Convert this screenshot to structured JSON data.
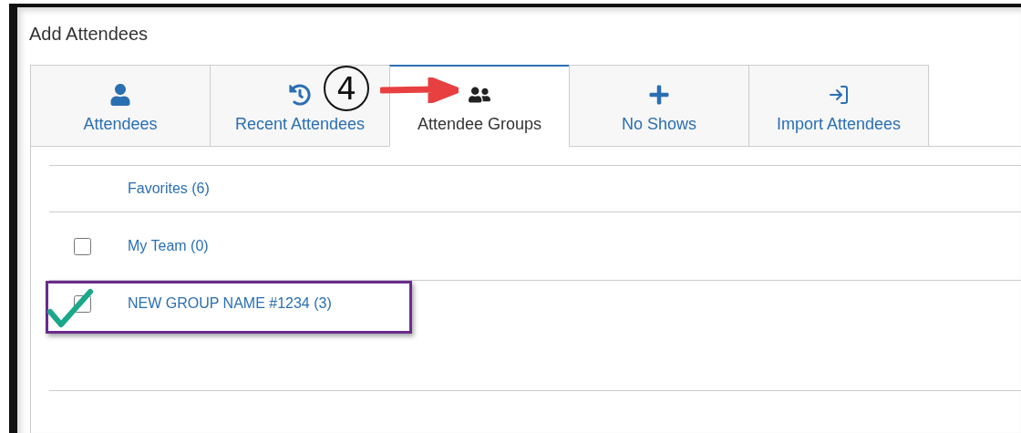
{
  "dialog": {
    "title": "Add Attendees"
  },
  "tabs": [
    {
      "label": "Attendees",
      "selected": false
    },
    {
      "label": "Recent Attendees",
      "selected": false
    },
    {
      "label": "Attendee Groups",
      "selected": true
    },
    {
      "label": "No Shows",
      "selected": false
    },
    {
      "label": "Import Attendees",
      "selected": false
    }
  ],
  "annotation": {
    "step": "4"
  },
  "groups": [
    {
      "label": "Favorites (6)",
      "kind": "plain",
      "highlighted": false
    },
    {
      "label": "My Team (0)",
      "kind": "checkbox",
      "checked": false,
      "highlighted": false
    },
    {
      "label": "NEW GROUP NAME #1234 (3)",
      "kind": "checkbox",
      "checked": false,
      "highlighted": true
    }
  ]
}
